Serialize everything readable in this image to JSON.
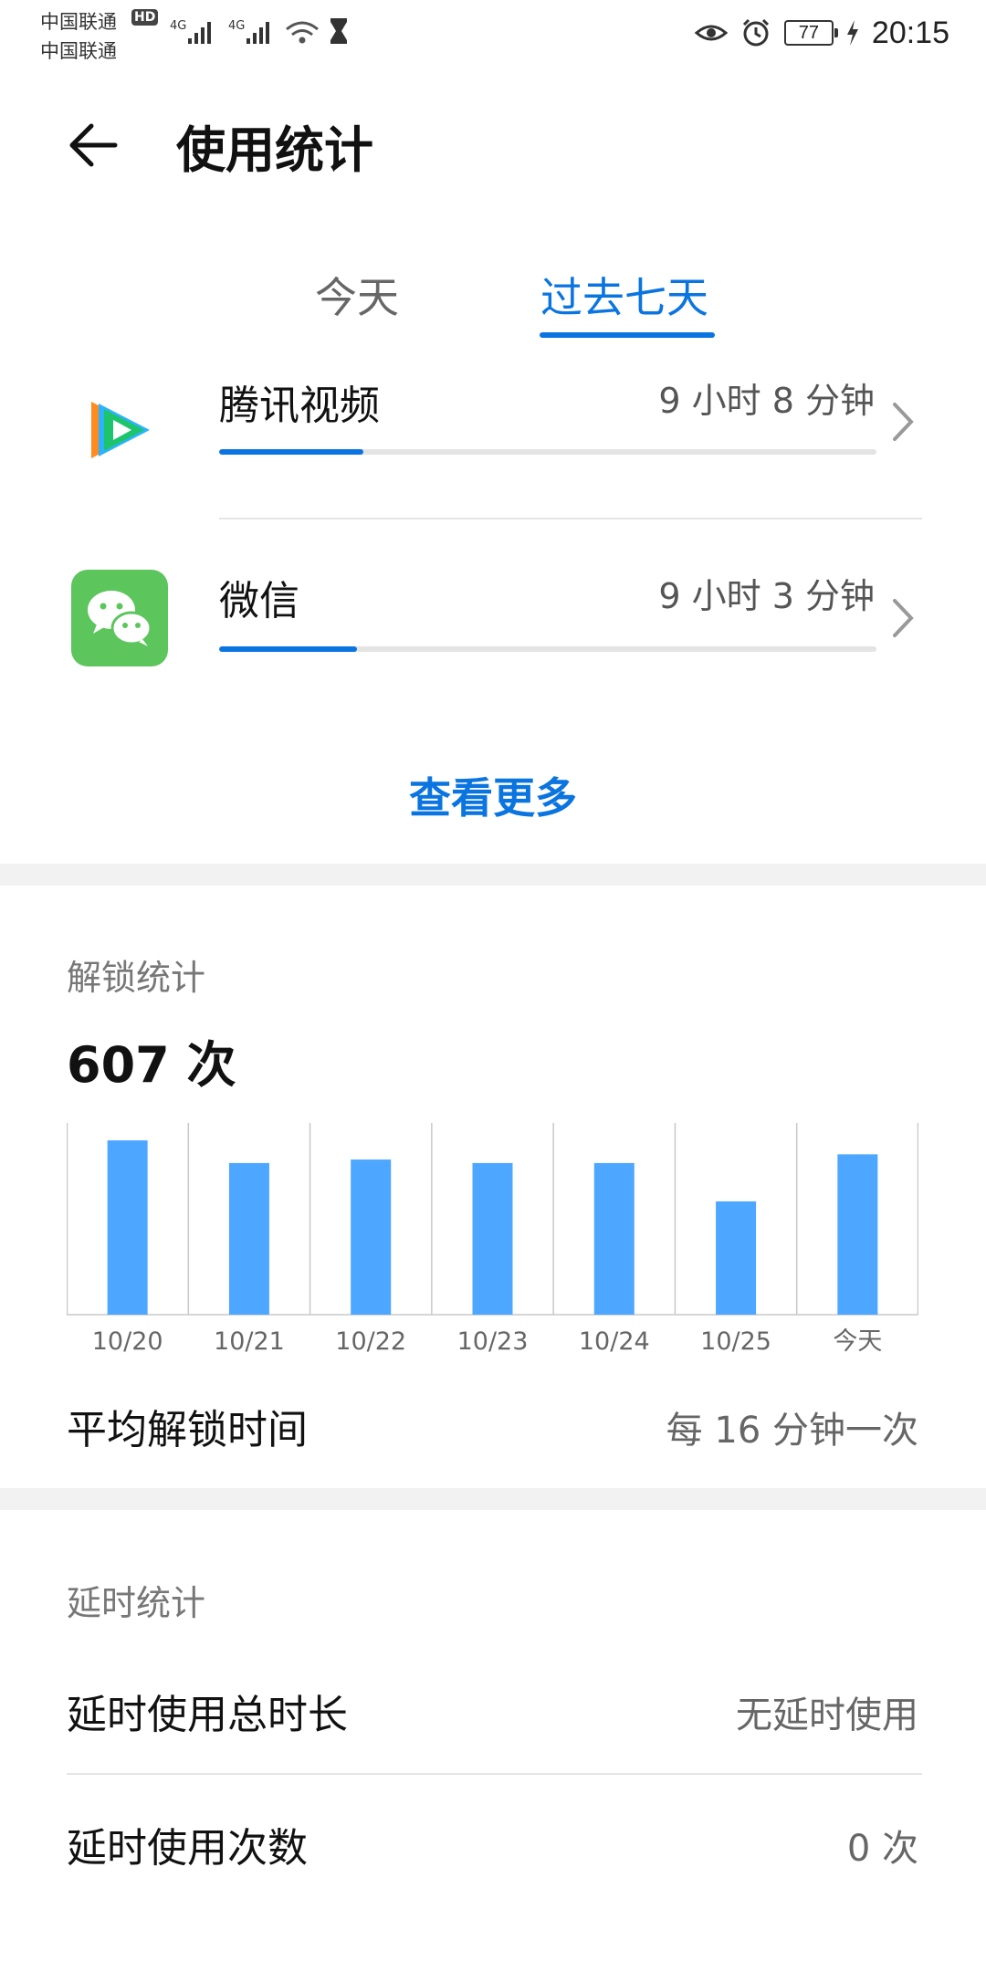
{
  "status_bar": {
    "carrier_1": "中国联通",
    "carrier_2": "中国联通",
    "hd_badge": "HD",
    "network_1": "4G",
    "network_2": "4G",
    "battery": "77",
    "time": "20:15",
    "icons": [
      "signal-icon",
      "signal-icon",
      "wifi-icon",
      "hourglass-icon",
      "eye-icon",
      "alarm-icon",
      "battery-icon",
      "charging-icon"
    ]
  },
  "header": {
    "title": "使用统计"
  },
  "tabs": [
    {
      "label": "今天",
      "selected": false
    },
    {
      "label": "过去七天",
      "selected": true
    }
  ],
  "apps": [
    {
      "name": "腾讯视频",
      "time": "9 小时 8 分钟",
      "progress_fraction": 0.22,
      "icon": "tencent-video-icon"
    },
    {
      "name": "微信",
      "time": "9 小时 3 分钟",
      "progress_fraction": 0.21,
      "icon": "wechat-icon"
    }
  ],
  "view_more": "查看更多",
  "unlock": {
    "section_label": "解锁统计",
    "count": "607 次",
    "average_label": "平均解锁时间",
    "average_value": "每 16 分钟一次"
  },
  "chart_data": {
    "type": "bar",
    "categories": [
      "10/20",
      "10/21",
      "10/22",
      "10/23",
      "10/24",
      "10/25",
      "今天"
    ],
    "values": [
      100,
      87,
      89,
      87,
      87,
      65,
      92
    ],
    "ylim": [
      0,
      110
    ],
    "grid": "vertical separators",
    "bar_color": "#4da6ff",
    "title": "",
    "xlabel": "",
    "ylabel": ""
  },
  "delay": {
    "section_label": "延时统计",
    "rows": [
      {
        "label": "延时使用总时长",
        "value": "无延时使用"
      },
      {
        "label": "延时使用次数",
        "value": "0 次"
      }
    ]
  },
  "colors": {
    "accent": "#0a74e0",
    "bar": "#4da6ff",
    "wechat_green": "#5cc55c"
  }
}
